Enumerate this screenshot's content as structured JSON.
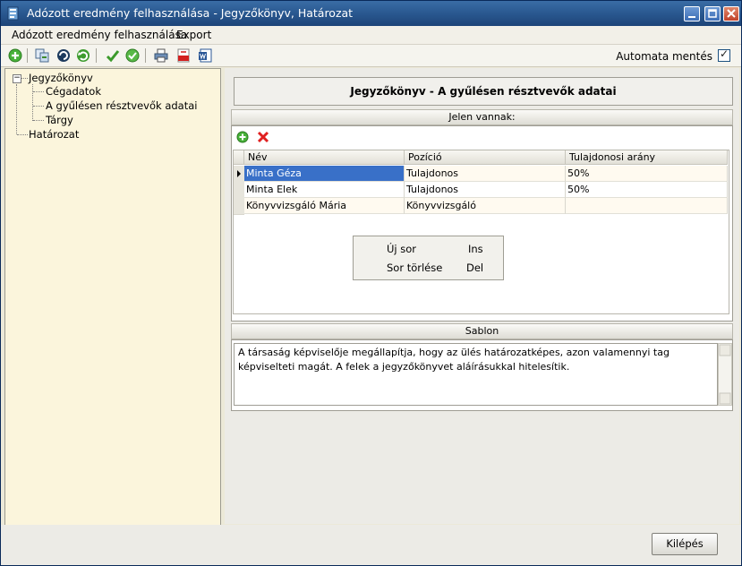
{
  "window": {
    "title": "Adózott eredmény felhasználása - Jegyzőkönyv, Határozat"
  },
  "menu": {
    "items": [
      "Adózott eredmény felhasználása",
      "Export"
    ]
  },
  "toolbar": {
    "icons": [
      "add-icon",
      "copy-icon",
      "refresh-icon",
      "undo-icon",
      "check-icon",
      "check-all-icon",
      "print-icon",
      "pdf-icon",
      "word-icon"
    ],
    "autosave_label": "Automata mentés",
    "autosave_checked": true
  },
  "tree": {
    "root1": "Jegyzőkönyv",
    "children": [
      "Cégadatok",
      "A gyűlésen résztvevők adatai",
      "Tárgy"
    ],
    "root2": "Határozat"
  },
  "header": {
    "title": "Jegyzőkönyv - A gyűlésen résztvevők adatai"
  },
  "attendees": {
    "group_title": "Jelen vannak:",
    "columns": [
      "Név",
      "Pozíció",
      "Tulajdonosi arány"
    ],
    "rows": [
      {
        "nev": "Minta Géza",
        "pozicio": "Tulajdonos",
        "arany": "50%"
      },
      {
        "nev": "Minta Elek",
        "pozicio": "Tulajdonos",
        "arany": "50%"
      },
      {
        "nev": "Könyvvizsgáló Mária",
        "pozicio": "Könyvvizsgáló",
        "arany": ""
      }
    ],
    "shortcuts": [
      {
        "label": "Új sor",
        "key": "Ins"
      },
      {
        "label": "Sor törlése",
        "key": "Del"
      }
    ]
  },
  "template": {
    "group_title": "Sablon",
    "text": "A társaság képviselője megállapítja, hogy az ülés határozatképes, azon valamennyi tag képviselteti magát. A felek a jegyzőkönyvet aláírásukkal hitelesítik."
  },
  "footer": {
    "exit_label": "Kilépés"
  }
}
